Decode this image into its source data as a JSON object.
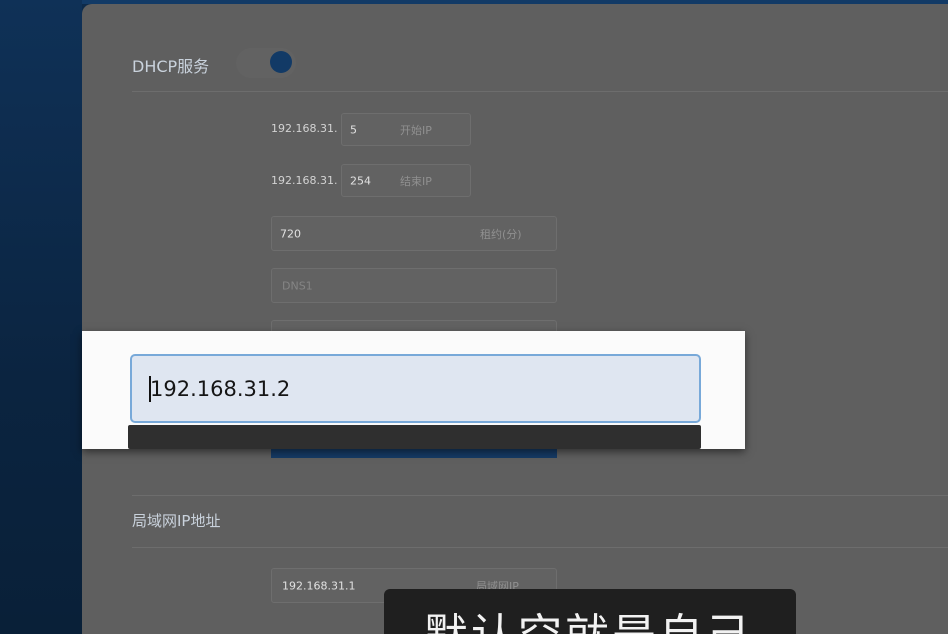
{
  "dhcp": {
    "title": "DHCP服务",
    "start": {
      "prefix": "192.168.31.",
      "value": "5",
      "label": "开始IP"
    },
    "end": {
      "prefix": "192.168.31.",
      "value": "254",
      "label": "结束IP"
    },
    "lease": {
      "value": "720",
      "label": "租约(分)"
    },
    "dns1": {
      "placeholder": "DNS1"
    }
  },
  "popup": {
    "input_value": "192.168.31.2"
  },
  "lan": {
    "title": "局域网IP地址",
    "ip": {
      "value": "192.168.31.1",
      "label": "局域网IP"
    }
  },
  "subtitle": "默认空就是自己",
  "colors": {
    "accent": "#123a66",
    "popup_border": "#78a9d9"
  }
}
